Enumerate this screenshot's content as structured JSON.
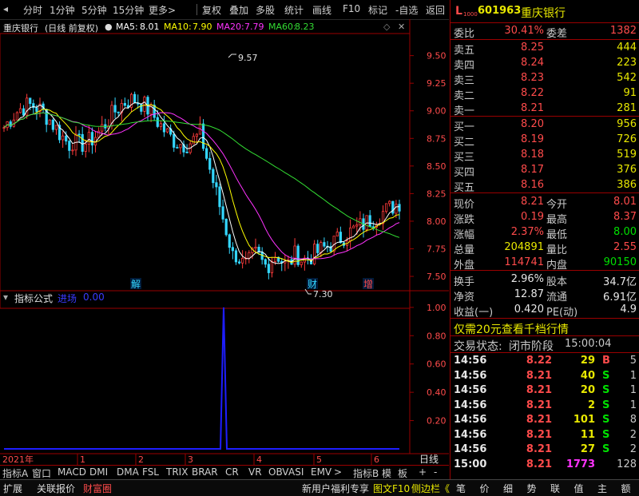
{
  "toolbar": {
    "items": [
      "分时",
      "1分钟",
      "5分钟",
      "15分钟",
      "更多>",
      "复权",
      "叠加",
      "多股",
      "统计",
      "画线",
      "F10",
      "标记",
      "-自选",
      "返回"
    ]
  },
  "chart_header": {
    "stock_name": "重庆银行",
    "period": "(日线 前复权)",
    "ma5_label": "MA5:",
    "ma5": "8.01",
    "ma10_label": "MA10:",
    "ma10": "7.90",
    "ma20_label": "MA20:",
    "ma20": "7.79",
    "ma60_label": "MA60:",
    "ma60": "8.23",
    "colors": {
      "ma5": "#ffffff",
      "ma10": "#ffff00",
      "ma20": "#ff33ff",
      "ma60": "#33dd33"
    }
  },
  "chart_data": [
    {
      "type": "candlestick",
      "title": "",
      "y_ticks": [
        "9.50",
        "9.25",
        "9.00",
        "8.75",
        "8.50",
        "8.25",
        "8.00",
        "7.75",
        "7.50"
      ],
      "ylim": [
        7.37,
        9.7
      ],
      "annotations": {
        "high_label": "9.57",
        "low_label": "7.30",
        "events": [
          "解",
          "财",
          "增"
        ]
      },
      "series_ma": [
        {
          "name": "MA5"
        },
        {
          "name": "MA10"
        },
        {
          "name": "MA20"
        },
        {
          "name": "MA60"
        }
      ]
    },
    {
      "type": "line",
      "title": "指标公式",
      "series": [
        {
          "name": "进场",
          "value_label": "0.00"
        }
      ],
      "y_ticks": [
        "1.00",
        "0.80",
        "0.60",
        "0.40",
        "0.20"
      ],
      "ylim": [
        0,
        1.05
      ]
    }
  ],
  "x_axis": {
    "year": "2021年",
    "months": [
      "1",
      "2",
      "3",
      "4",
      "5",
      "6"
    ],
    "right_label": "日线"
  },
  "indicator_tabs": [
    "指标A",
    "窗口",
    "MACD",
    "DMI",
    "DMA",
    "FSL",
    "TRIX",
    "BRAR",
    "CR",
    "VR",
    "OBV",
    "ASI",
    "EMV",
    ">",
    "指标B",
    "模",
    "板",
    "+",
    "-"
  ],
  "status_bar": {
    "left": [
      "扩展",
      "关联报价",
      "财富圈"
    ],
    "right": [
      "新用户福利专享",
      "图文F10",
      "侧边栏《"
    ],
    "panel_tabs": [
      "笔",
      "价",
      "细",
      "势",
      "联",
      "值",
      "主",
      "额"
    ]
  },
  "quote": {
    "code_prefix": "L",
    "code_sub": "1000",
    "code": "601963",
    "name": "重庆银行",
    "webi_label": "委比",
    "webi": "30.41%",
    "wecha_label": "委差",
    "wecha": "1382",
    "asks": [
      {
        "label": "卖五",
        "price": "8.25",
        "vol": "444"
      },
      {
        "label": "卖四",
        "price": "8.24",
        "vol": "223"
      },
      {
        "label": "卖三",
        "price": "8.23",
        "vol": "542"
      },
      {
        "label": "卖二",
        "price": "8.22",
        "vol": "91"
      },
      {
        "label": "卖一",
        "price": "8.21",
        "vol": "281"
      }
    ],
    "bids": [
      {
        "label": "买一",
        "price": "8.20",
        "vol": "956"
      },
      {
        "label": "买二",
        "price": "8.19",
        "vol": "726"
      },
      {
        "label": "买三",
        "price": "8.18",
        "vol": "519"
      },
      {
        "label": "买四",
        "price": "8.17",
        "vol": "376"
      },
      {
        "label": "买五",
        "price": "8.16",
        "vol": "386"
      }
    ],
    "stats": [
      {
        "l1": "现价",
        "v1": "8.21",
        "l2": "今开",
        "v2": "8.01"
      },
      {
        "l1": "涨跌",
        "v1": "0.19",
        "l2": "最高",
        "v2": "8.37"
      },
      {
        "l1": "涨幅",
        "v1": "2.37%",
        "l2": "最低",
        "v2": "8.00"
      },
      {
        "l1": "总量",
        "v1": "204891",
        "l2": "量比",
        "v2": "2.55"
      },
      {
        "l1": "外盘",
        "v1": "114741",
        "l2": "内盘",
        "v2": "90150"
      }
    ],
    "stats2": [
      {
        "l1": "换手",
        "v1": "2.96%",
        "l2": "股本",
        "v2": "34.7亿"
      },
      {
        "l1": "净资",
        "v1": "12.87",
        "l2": "流通",
        "v2": "6.91亿"
      },
      {
        "l1": "收益(一)",
        "v1": "0.420",
        "l2": "PE(动)",
        "v2": "4.9"
      }
    ],
    "promo": "仅需20元查看千档行情",
    "trade_status_label": "交易状态:",
    "trade_status": "闭市阶段",
    "trade_time": "15:00:04",
    "ticks": [
      {
        "t": "14:56",
        "p": "8.22",
        "v": "29",
        "d": "B",
        "n": "5"
      },
      {
        "t": "14:56",
        "p": "8.21",
        "v": "40",
        "d": "S",
        "n": "1"
      },
      {
        "t": "14:56",
        "p": "8.21",
        "v": "20",
        "d": "S",
        "n": "1"
      },
      {
        "t": "14:56",
        "p": "8.21",
        "v": "2",
        "d": "S",
        "n": "1"
      },
      {
        "t": "14:56",
        "p": "8.21",
        "v": "101",
        "d": "S",
        "n": "8"
      },
      {
        "t": "14:56",
        "p": "8.21",
        "v": "11",
        "d": "S",
        "n": "2"
      },
      {
        "t": "14:56",
        "p": "8.21",
        "v": "27",
        "d": "S",
        "n": "2"
      },
      {
        "t": "15:00",
        "p": "8.21",
        "v": "1773",
        "d": "",
        "n": "128"
      }
    ]
  }
}
